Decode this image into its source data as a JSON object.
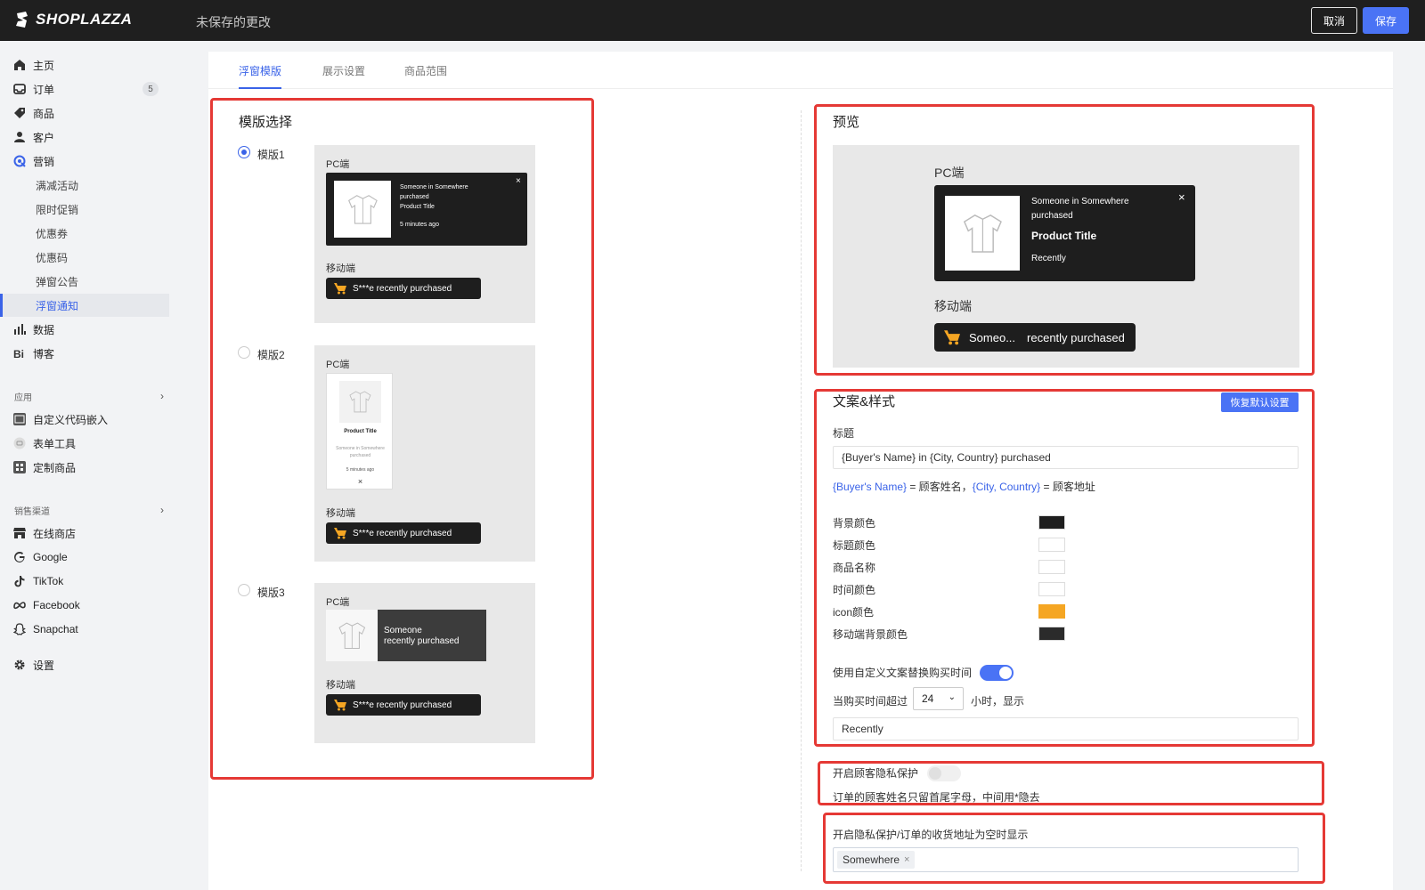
{
  "topbar": {
    "logo": "SHOPLAZZA",
    "unsaved": "未保存的更改",
    "cancel_label": "取消",
    "save_label": "保存"
  },
  "sidebar": {
    "items": [
      {
        "label": "主页",
        "icon": "home-icon"
      },
      {
        "label": "订单",
        "icon": "inbox-icon",
        "badge": "5"
      },
      {
        "label": "商品",
        "icon": "tag-icon"
      },
      {
        "label": "客户",
        "icon": "user-icon"
      },
      {
        "label": "营销",
        "icon": "marketing-icon"
      }
    ],
    "marketing_sub": [
      "满减活动",
      "限时促销",
      "优惠券",
      "优惠码",
      "弹窗公告",
      "浮窗通知"
    ],
    "items2": [
      {
        "label": "数据",
        "icon": "chart-icon"
      },
      {
        "label": "博客",
        "icon": "blog-icon"
      }
    ],
    "apps_title": "应用",
    "apps": [
      {
        "label": "自定义代码嵌入",
        "icon": "code-icon"
      },
      {
        "label": "表单工具",
        "icon": "form-icon"
      },
      {
        "label": "定制商品",
        "icon": "custom-product-icon"
      }
    ],
    "channels_title": "销售渠道",
    "channels": [
      {
        "label": "在线商店",
        "icon": "store-icon"
      },
      {
        "label": "Google",
        "icon": "google-icon"
      },
      {
        "label": "TikTok",
        "icon": "tiktok-icon"
      },
      {
        "label": "Facebook",
        "icon": "meta-icon"
      },
      {
        "label": "Snapchat",
        "icon": "snapchat-icon"
      }
    ],
    "settings": {
      "label": "设置",
      "icon": "gear-icon"
    }
  },
  "tabs": [
    "浮窗模版",
    "展示设置",
    "商品范围"
  ],
  "templates": {
    "title": "模版选择",
    "options": [
      "模版1",
      "模版2",
      "模版3"
    ],
    "selected": "模版1",
    "pc_label": "PC端",
    "mobile_label": "移动端",
    "t1": {
      "line1": "Someone in Somewhere",
      "line2": "purchased",
      "line3": "Product Title",
      "time": "5 minutes ago",
      "close": "×"
    },
    "t2": {
      "title": "Product Title",
      "line1": "Someone in Somewhere",
      "line2": "purchased",
      "time": "5 minutes ago",
      "close": "×"
    },
    "t3": {
      "line1": "Someone",
      "line2": "recently purchased"
    },
    "mobile_text": "S***e recently purchased"
  },
  "preview": {
    "title": "预览",
    "pc_label": "PC端",
    "mobile_label": "移动端",
    "line1": "Someone in Somewhere",
    "line2": "purchased",
    "product": "Product Title",
    "time": "Recently",
    "close": "×",
    "mobile_name": "Someo...",
    "mobile_text": "recently purchased"
  },
  "style": {
    "title": "文案&样式",
    "reset_label": "恢复默认设置",
    "title_label": "标题",
    "title_value": "{Buyer's Name} in {City, Country} purchased",
    "hint_var1": "{Buyer's Name}",
    "hint_text1": " = 顾客姓名，",
    "hint_var2": "{City, Country}",
    "hint_text2": " = 顾客地址",
    "colors": [
      {
        "label": "背景颜色",
        "color": "#1e1e1e"
      },
      {
        "label": "标题颜色",
        "color": "#ffffff"
      },
      {
        "label": "商品名称",
        "color": "#ffffff"
      },
      {
        "label": "时间颜色",
        "color": "#ffffff"
      },
      {
        "label": "icon颜色",
        "color": "#f5a623"
      },
      {
        "label": "移动端背景颜色",
        "color": "#2b2b2b"
      }
    ],
    "custom_time_label": "使用自定义文案替换购买时间",
    "custom_time_enabled": true,
    "when_label": "当购买时间超过",
    "hours_value": "24",
    "hours_suffix": "小时，显示",
    "recent_value": "Recently"
  },
  "privacy": {
    "label": "开启顾客隐私保护",
    "enabled": false,
    "desc": "订单的顾客姓名只留首尾字母，中间用*隐去"
  },
  "address": {
    "label": "开启隐私保护/订单的收货地址为空时显示",
    "tag": "Somewhere",
    "tag_remove": "×"
  }
}
